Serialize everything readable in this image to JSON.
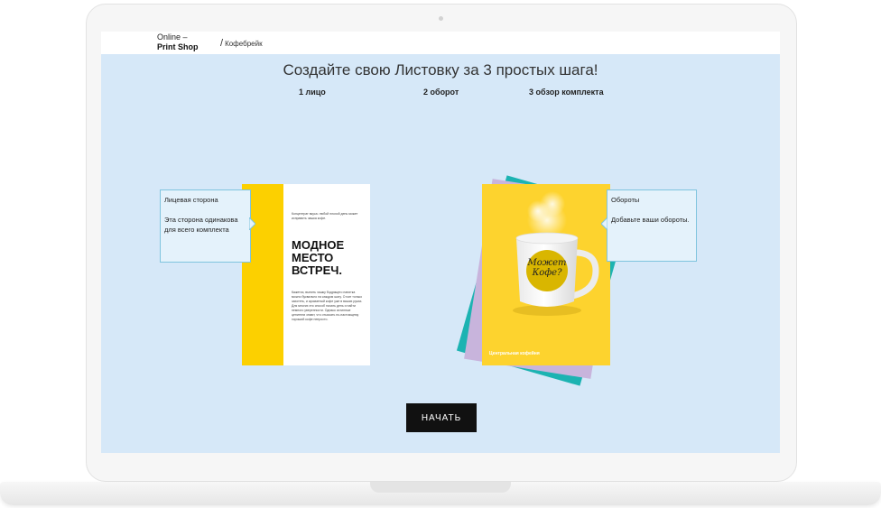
{
  "header": {
    "logo_line1": "Online –",
    "logo_line2": "Print Shop",
    "breadcrumb_separator": "/",
    "breadcrumb_item": "Кофебрейк"
  },
  "main": {
    "title": "Создайте свою Листовку за 3 простых шага!",
    "steps": [
      {
        "label": "1 лицо"
      },
      {
        "label": "2 оборот"
      },
      {
        "label": "3 обзор комплекта"
      }
    ]
  },
  "front_tooltip": {
    "title": "Лицевая сторона",
    "text": "Эта сторона одинакова для всего комплекта"
  },
  "back_tooltip": {
    "title": "Обороты",
    "text": "Добавьте ваши обороты."
  },
  "front_card": {
    "small_text": "Концентрат вкуса: любой плохой день может исправить чашка кофе.",
    "headline": "МОДНОЕ МЕСТО ВСТРЕЧ.",
    "body_text": "Кажется, выпить чашку бодрящего напитка можно буквально на каждом шагу. Стоит только захотеть, и ароматный кофе уже в ваших руках. Для многих это способ начать день и найти немного уверенности. Однако истинные ценители знают, что отыскать по-настоящему хороший кофе непросто."
  },
  "back_card": {
    "mug_text": "Может Кофе?",
    "footer": "Центральная кофейня"
  },
  "actions": {
    "start_label": "НАЧАТЬ"
  },
  "colors": {
    "screen_bg": "#d6e8f8",
    "front_stripe": "#fcd000",
    "back_card": "#fdd32e",
    "teal_layer": "#1cb3b2",
    "lilac_layer": "#c8b4dc",
    "tooltip_border": "#7fc4de",
    "button_bg": "#111111"
  }
}
